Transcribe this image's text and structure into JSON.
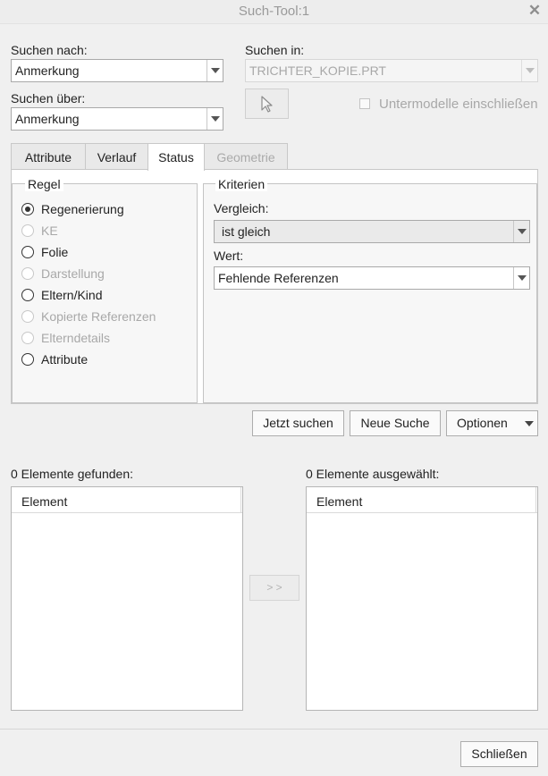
{
  "window": {
    "title": "Such-Tool:1",
    "close_glyph": "✕"
  },
  "search_for": {
    "label": "Suchen nach:",
    "value": "Anmerkung"
  },
  "search_via": {
    "label": "Suchen über:",
    "value": "Anmerkung"
  },
  "search_in": {
    "label": "Suchen in:",
    "value": "TRICHTER_KOPIE.PRT"
  },
  "include_submodels": {
    "label": "Untermodelle einschließen",
    "checked": false
  },
  "tabs": [
    {
      "label": "Attribute",
      "state": "normal"
    },
    {
      "label": "Verlauf",
      "state": "normal"
    },
    {
      "label": "Status",
      "state": "active"
    },
    {
      "label": "Geometrie",
      "state": "disabled"
    }
  ],
  "rule": {
    "legend": "Regel",
    "options": [
      {
        "label": "Regenerierung",
        "checked": true,
        "enabled": true
      },
      {
        "label": "KE",
        "checked": false,
        "enabled": false
      },
      {
        "label": "Folie",
        "checked": false,
        "enabled": true
      },
      {
        "label": "Darstellung",
        "checked": false,
        "enabled": false
      },
      {
        "label": "Eltern/Kind",
        "checked": false,
        "enabled": true
      },
      {
        "label": "Kopierte Referenzen",
        "checked": false,
        "enabled": false
      },
      {
        "label": "Elterndetails",
        "checked": false,
        "enabled": false
      },
      {
        "label": "Attribute",
        "checked": false,
        "enabled": true
      }
    ]
  },
  "criteria": {
    "legend": "Kriterien",
    "compare_label": "Vergleich:",
    "compare_value": "ist gleich",
    "value_label": "Wert:",
    "value_value": "Fehlende Referenzen"
  },
  "actions": {
    "search_now": "Jetzt suchen",
    "new_search": "Neue Suche",
    "options": "Optionen"
  },
  "results": {
    "found_label": "0 Elemente gefunden:",
    "found_column": "Element",
    "selected_label": "0 Elemente ausgewählt:",
    "selected_column": "Element",
    "transfer_label": "> >"
  },
  "footer": {
    "close": "Schließen"
  },
  "icons": {
    "pick": "cursor-arrow-icon",
    "dropdown": "chevron-down-icon"
  }
}
